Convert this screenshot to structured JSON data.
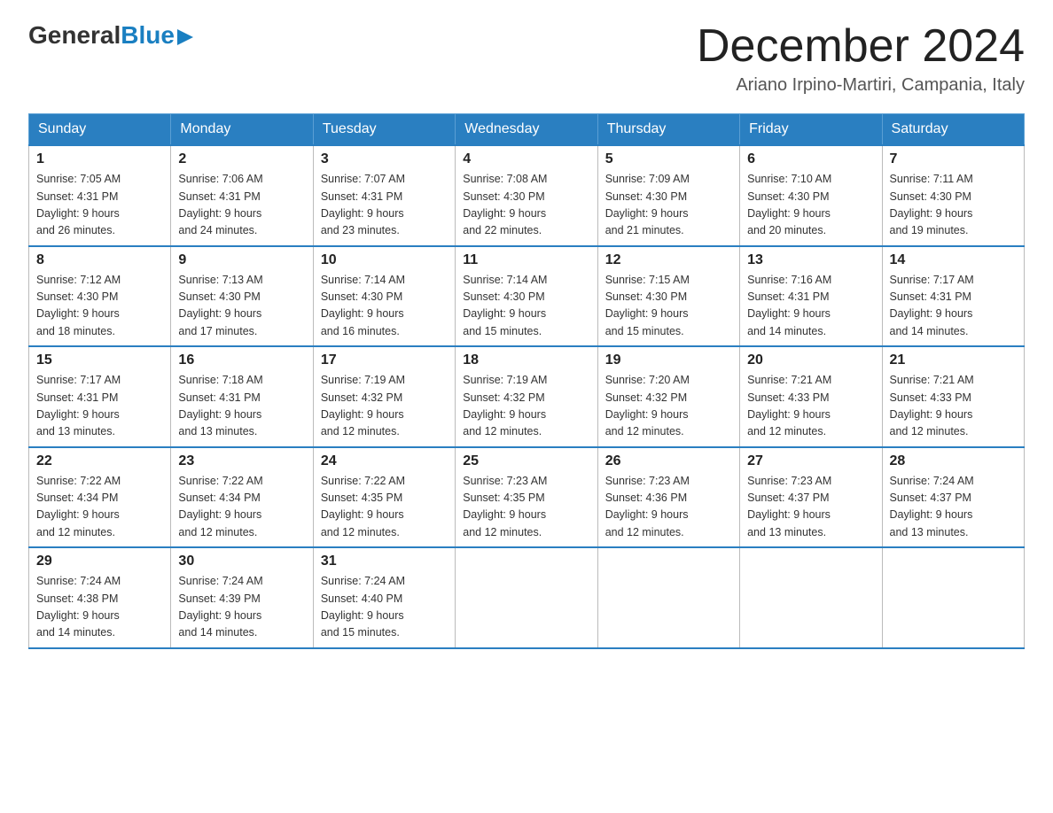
{
  "header": {
    "logo": {
      "general": "General",
      "blue": "Blue",
      "arrow": "▶"
    },
    "title": "December 2024",
    "location": "Ariano Irpino-Martiri, Campania, Italy"
  },
  "calendar": {
    "days_of_week": [
      "Sunday",
      "Monday",
      "Tuesday",
      "Wednesday",
      "Thursday",
      "Friday",
      "Saturday"
    ],
    "weeks": [
      [
        {
          "day": "1",
          "sunrise": "7:05 AM",
          "sunset": "4:31 PM",
          "daylight": "9 hours and 26 minutes."
        },
        {
          "day": "2",
          "sunrise": "7:06 AM",
          "sunset": "4:31 PM",
          "daylight": "9 hours and 24 minutes."
        },
        {
          "day": "3",
          "sunrise": "7:07 AM",
          "sunset": "4:31 PM",
          "daylight": "9 hours and 23 minutes."
        },
        {
          "day": "4",
          "sunrise": "7:08 AM",
          "sunset": "4:30 PM",
          "daylight": "9 hours and 22 minutes."
        },
        {
          "day": "5",
          "sunrise": "7:09 AM",
          "sunset": "4:30 PM",
          "daylight": "9 hours and 21 minutes."
        },
        {
          "day": "6",
          "sunrise": "7:10 AM",
          "sunset": "4:30 PM",
          "daylight": "9 hours and 20 minutes."
        },
        {
          "day": "7",
          "sunrise": "7:11 AM",
          "sunset": "4:30 PM",
          "daylight": "9 hours and 19 minutes."
        }
      ],
      [
        {
          "day": "8",
          "sunrise": "7:12 AM",
          "sunset": "4:30 PM",
          "daylight": "9 hours and 18 minutes."
        },
        {
          "day": "9",
          "sunrise": "7:13 AM",
          "sunset": "4:30 PM",
          "daylight": "9 hours and 17 minutes."
        },
        {
          "day": "10",
          "sunrise": "7:14 AM",
          "sunset": "4:30 PM",
          "daylight": "9 hours and 16 minutes."
        },
        {
          "day": "11",
          "sunrise": "7:14 AM",
          "sunset": "4:30 PM",
          "daylight": "9 hours and 15 minutes."
        },
        {
          "day": "12",
          "sunrise": "7:15 AM",
          "sunset": "4:30 PM",
          "daylight": "9 hours and 15 minutes."
        },
        {
          "day": "13",
          "sunrise": "7:16 AM",
          "sunset": "4:31 PM",
          "daylight": "9 hours and 14 minutes."
        },
        {
          "day": "14",
          "sunrise": "7:17 AM",
          "sunset": "4:31 PM",
          "daylight": "9 hours and 14 minutes."
        }
      ],
      [
        {
          "day": "15",
          "sunrise": "7:17 AM",
          "sunset": "4:31 PM",
          "daylight": "9 hours and 13 minutes."
        },
        {
          "day": "16",
          "sunrise": "7:18 AM",
          "sunset": "4:31 PM",
          "daylight": "9 hours and 13 minutes."
        },
        {
          "day": "17",
          "sunrise": "7:19 AM",
          "sunset": "4:32 PM",
          "daylight": "9 hours and 12 minutes."
        },
        {
          "day": "18",
          "sunrise": "7:19 AM",
          "sunset": "4:32 PM",
          "daylight": "9 hours and 12 minutes."
        },
        {
          "day": "19",
          "sunrise": "7:20 AM",
          "sunset": "4:32 PM",
          "daylight": "9 hours and 12 minutes."
        },
        {
          "day": "20",
          "sunrise": "7:21 AM",
          "sunset": "4:33 PM",
          "daylight": "9 hours and 12 minutes."
        },
        {
          "day": "21",
          "sunrise": "7:21 AM",
          "sunset": "4:33 PM",
          "daylight": "9 hours and 12 minutes."
        }
      ],
      [
        {
          "day": "22",
          "sunrise": "7:22 AM",
          "sunset": "4:34 PM",
          "daylight": "9 hours and 12 minutes."
        },
        {
          "day": "23",
          "sunrise": "7:22 AM",
          "sunset": "4:34 PM",
          "daylight": "9 hours and 12 minutes."
        },
        {
          "day": "24",
          "sunrise": "7:22 AM",
          "sunset": "4:35 PM",
          "daylight": "9 hours and 12 minutes."
        },
        {
          "day": "25",
          "sunrise": "7:23 AM",
          "sunset": "4:35 PM",
          "daylight": "9 hours and 12 minutes."
        },
        {
          "day": "26",
          "sunrise": "7:23 AM",
          "sunset": "4:36 PM",
          "daylight": "9 hours and 12 minutes."
        },
        {
          "day": "27",
          "sunrise": "7:23 AM",
          "sunset": "4:37 PM",
          "daylight": "9 hours and 13 minutes."
        },
        {
          "day": "28",
          "sunrise": "7:24 AM",
          "sunset": "4:37 PM",
          "daylight": "9 hours and 13 minutes."
        }
      ],
      [
        {
          "day": "29",
          "sunrise": "7:24 AM",
          "sunset": "4:38 PM",
          "daylight": "9 hours and 14 minutes."
        },
        {
          "day": "30",
          "sunrise": "7:24 AM",
          "sunset": "4:39 PM",
          "daylight": "9 hours and 14 minutes."
        },
        {
          "day": "31",
          "sunrise": "7:24 AM",
          "sunset": "4:40 PM",
          "daylight": "9 hours and 15 minutes."
        },
        null,
        null,
        null,
        null
      ]
    ]
  }
}
